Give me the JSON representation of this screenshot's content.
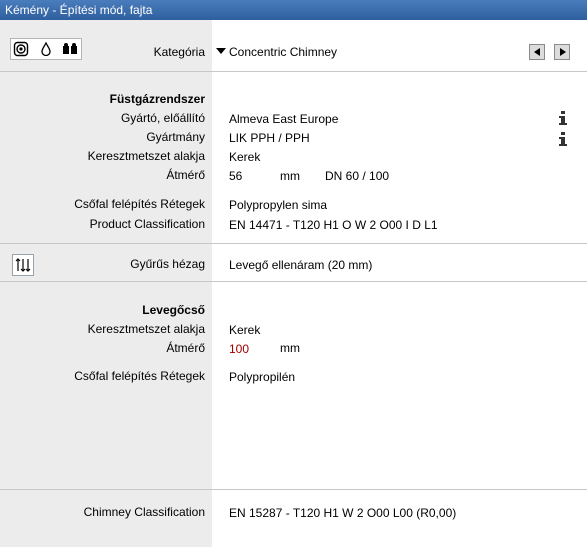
{
  "window": {
    "title": "Kémény - Építési mód, fajta"
  },
  "icons": [
    "chimney-icon",
    "drop-icon",
    "people-icon",
    "gap-icon",
    "info-icon"
  ],
  "category": {
    "label": "Kategória",
    "value": "Concentric Chimney"
  },
  "flue": {
    "header": "Füstgázrendszer",
    "manufacturer_label": "Gyártó, előállító",
    "manufacturer": "Almeva East Europe",
    "brand_label": "Gyártmány",
    "brand": "LIK PPH / PPH",
    "shape_label": "Keresztmetszet alakja",
    "shape": "Kerek",
    "diameter_label": "Átmérő",
    "diameter": "56",
    "diameter_unit": "mm",
    "dn": "DN 60 / 100",
    "layers_label": "Csőfal felépítés Rétegek",
    "layers": "Polypropylen sima",
    "classification_label": "Product Classification",
    "classification": "EN 14471 - T120 H1 O W 2 O00 I D L1"
  },
  "gap": {
    "label": "Gyűrűs hézag",
    "value": "Levegő ellenáram (20 mm)"
  },
  "air": {
    "header": "Levegőcső",
    "shape_label": "Keresztmetszet alakja",
    "shape": "Kerek",
    "diameter_label": "Átmérő",
    "diameter": "100",
    "diameter_unit": "mm",
    "layers_label": "Csőfal felépítés Rétegek",
    "layers": "Polypropilén"
  },
  "chimney": {
    "label": "Chimney Classification",
    "value": "EN 15287 - T120 H1 W 2 O00 L00 (R0,00)"
  }
}
